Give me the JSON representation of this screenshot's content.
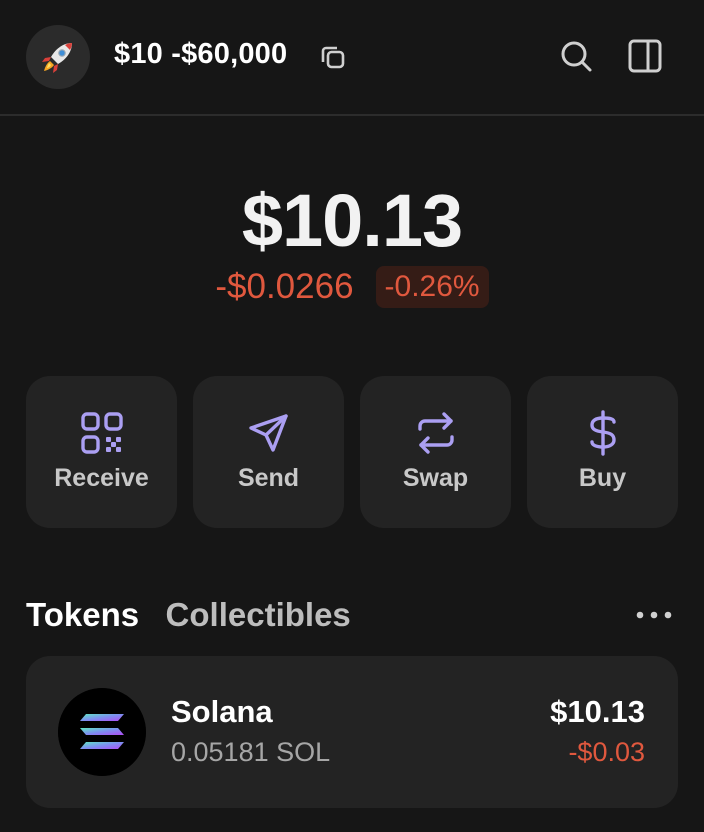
{
  "header": {
    "avatar_emoji": "🚀",
    "wallet_name": "$10 -$60,000",
    "icons": [
      "rocket-icon",
      "copy-icon",
      "search-icon",
      "side-panel-icon"
    ]
  },
  "balance": {
    "total": "$10.13",
    "change_usd": "-$0.0266",
    "change_pct": "-0.26%"
  },
  "actions": [
    {
      "label": "Receive",
      "icon": "qr-code-icon"
    },
    {
      "label": "Send",
      "icon": "send-icon"
    },
    {
      "label": "Swap",
      "icon": "swap-icon"
    },
    {
      "label": "Buy",
      "icon": "dollar-icon"
    }
  ],
  "tabs": {
    "tokens": "Tokens",
    "collectibles": "Collectibles",
    "active": "Tokens"
  },
  "tokens": [
    {
      "name": "Solana",
      "amount": "0.05181 SOL",
      "value": "$10.13",
      "change": "-$0.03",
      "icon": "solana-logo"
    }
  ],
  "colors": {
    "background": "#161616",
    "card": "#232323",
    "accent": "#ab9ff2",
    "negative": "#e0583e",
    "negative_bg": "#351c16"
  }
}
